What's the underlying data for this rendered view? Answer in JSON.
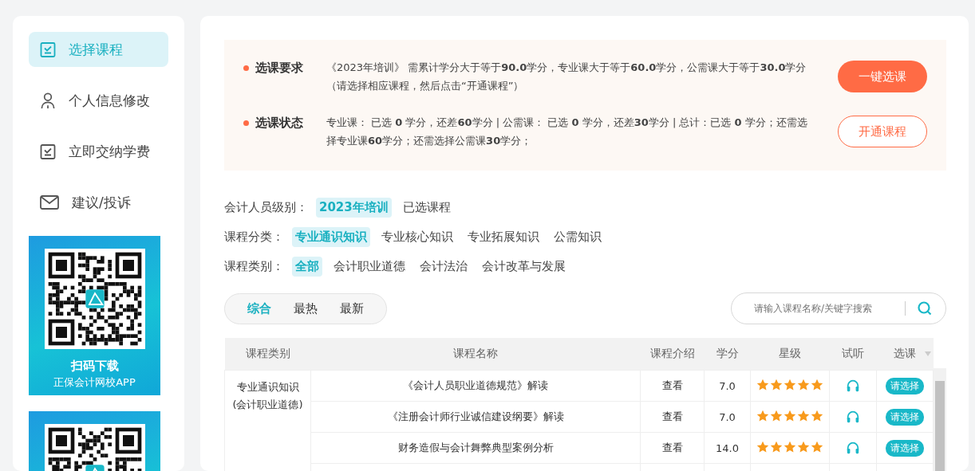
{
  "sidebar": {
    "items": [
      {
        "label": "选择课程",
        "selected": true
      },
      {
        "label": "个人信息修改",
        "selected": false
      },
      {
        "label": "立即交纳学费",
        "selected": false
      },
      {
        "label": "建议/投诉",
        "selected": false
      }
    ],
    "banners": [
      {
        "title": "扫码下载",
        "subtitle": "正保会计网校APP"
      }
    ]
  },
  "requirements": [
    {
      "label": "选课要求",
      "text": "《2023年培训》 需累计学分大于等于**90.0**学分，专业课大于等于**60.0**学分，公需课大于等于**30.0**学分（请选择相应课程，然后点击“开通课程”）",
      "button": "一键选课"
    },
    {
      "label": "选课状态",
      "text": "专业课：  已选 **0** 学分，还差**60**学分 | 公需课：  已选 **0** 学分，还差**30**学分 | 总计：已选 **0** 学分；还需选择专业课**60**学分；还需选择公需课**30**学分；",
      "button": "开通课程"
    }
  ],
  "filters": [
    {
      "label": "会计人员级别：",
      "options": [
        {
          "label": "2023年培训",
          "selected": true
        },
        {
          "label": "已选课程",
          "selected": false
        }
      ]
    },
    {
      "label": "课程分类：",
      "options": [
        {
          "label": "专业通识知识",
          "selected": true
        },
        {
          "label": "专业核心知识",
          "selected": false
        },
        {
          "label": "专业拓展知识",
          "selected": false
        },
        {
          "label": "公需知识",
          "selected": false
        }
      ]
    },
    {
      "label": "课程类别：",
      "options": [
        {
          "label": "全部",
          "selected": true
        },
        {
          "label": "会计职业道德",
          "selected": false
        },
        {
          "label": "会计法治",
          "selected": false
        },
        {
          "label": "会计改革与发展",
          "selected": false
        }
      ]
    }
  ],
  "sort_tabs": [
    {
      "label": "综合",
      "selected": true
    },
    {
      "label": "最热",
      "selected": false
    },
    {
      "label": "最新",
      "selected": false
    }
  ],
  "search": {
    "placeholder": "请输入课程名称/关键字搜索"
  },
  "table": {
    "columns": [
      "课程类别",
      "课程名称",
      "课程介绍",
      "学分",
      "星级",
      "试听",
      "选课"
    ],
    "groups": [
      {
        "category": [
          "专业通识知识",
          "(会计职业道德)"
        ],
        "rows": [
          {
            "name": "《会计人员职业道德规范》解读",
            "intro": "查看",
            "credit": "7.0",
            "stars": 5,
            "action": "请选择"
          },
          {
            "name": "《注册会计师行业诚信建设纲要》解读",
            "intro": "查看",
            "credit": "7.0",
            "stars": 5,
            "action": "请选择"
          },
          {
            "name": "财务造假与会计舞弊典型案例分析",
            "intro": "查看",
            "credit": "14.0",
            "stars": 5,
            "action": "请选择"
          }
        ]
      }
    ]
  }
}
